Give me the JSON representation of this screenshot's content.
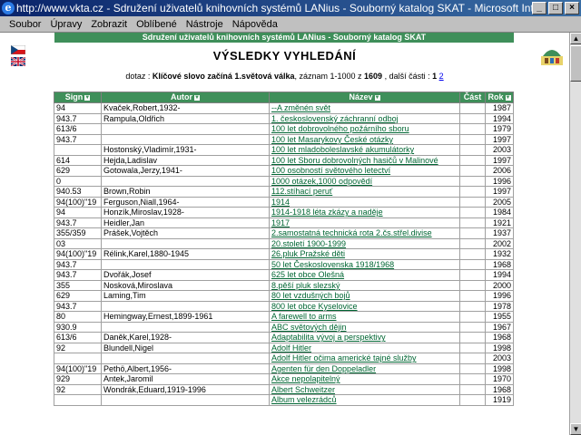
{
  "window": {
    "title": "http://www.vkta.cz - Sdružení uživatelů knihovních systémů LANius - Souborný katalog SKAT - Microsoft Interne..."
  },
  "menu": [
    "Soubor",
    "Úpravy",
    "Zobrazit",
    "Oblíbené",
    "Nástroje",
    "Nápověda"
  ],
  "banner": "Sdružení uživatelů knihovních systémů LANius - Souborný katalog SKAT",
  "heading": "VÝSLEDKY VYHLEDÁNÍ",
  "query": {
    "prefix": "dotaz : ",
    "query_text": "Klíčové slovo začíná 1.světová válka",
    "middle": ", záznam 1-1000 z ",
    "total": "1609",
    "suffix": " , další části : ",
    "current_page": "1",
    "next_page": "2"
  },
  "table": {
    "headers": [
      "Sign",
      "Autor",
      "Název",
      "Část",
      "Rok"
    ],
    "rows": [
      {
        "sign": "94",
        "author": "Kvaček,Robert,1932-",
        "title": "--A změnén svět",
        "part": "",
        "year": "1987"
      },
      {
        "sign": "943.7",
        "author": "Rampula,Oldřich",
        "title": "1. československý záchranní odboj",
        "part": "",
        "year": "1994"
      },
      {
        "sign": "613/6",
        "author": "",
        "title": "100 let dobrovolného požárního sboru",
        "part": "",
        "year": "1979"
      },
      {
        "sign": "943.7",
        "author": "",
        "title": "100 let Masarykovy České otázky",
        "part": "",
        "year": "1997"
      },
      {
        "sign": "",
        "author": "Hostonský,Vladimír,1931-",
        "title": "100 let mladoboleslavské akumulátorky",
        "part": "",
        "year": "2003"
      },
      {
        "sign": "614",
        "author": "Hejda,Ladislav",
        "title": "100 let Sboru dobrovolných hasičů v Malinové",
        "part": "",
        "year": "1997"
      },
      {
        "sign": "629",
        "author": "Gotowala,Jerzy,1941-",
        "title": "100 osobností světového letectví",
        "part": "",
        "year": "2006"
      },
      {
        "sign": "0",
        "author": "",
        "title": "1000 otázek,1000 odpovědí",
        "part": "",
        "year": "1996"
      },
      {
        "sign": "940.53",
        "author": "Brown,Robin",
        "title": "112.stíhací peruť",
        "part": "",
        "year": "1997"
      },
      {
        "sign": "94(100)\"19",
        "author": "Ferguson,Niall,1964-",
        "title": "1914",
        "part": "",
        "year": "2005"
      },
      {
        "sign": "94",
        "author": "Honzík,Miroslav,1928-",
        "title": "1914-1918 léta zkázy a naděje",
        "part": "",
        "year": "1984"
      },
      {
        "sign": "943.7",
        "author": "Heidler,Jan",
        "title": "1917",
        "part": "",
        "year": "1921"
      },
      {
        "sign": "355/359",
        "author": "Prášek,Vojtěch",
        "title": "2.samostatná technická rota 2.čs.střel.divise",
        "part": "",
        "year": "1937"
      },
      {
        "sign": "03",
        "author": "",
        "title": "20.století 1900-1999",
        "part": "",
        "year": "2002"
      },
      {
        "sign": "94(100)\"19",
        "author": "Rélink,Karel,1880-1945",
        "title": "26.pluk Pražské děti",
        "part": "",
        "year": "1932"
      },
      {
        "sign": "943.7",
        "author": "",
        "title": "50 let Československa 1918/1968",
        "part": "",
        "year": "1968"
      },
      {
        "sign": "943.7",
        "author": "Dvořák,Josef",
        "title": "625 let obce Olešná",
        "part": "",
        "year": "1994"
      },
      {
        "sign": "355",
        "author": "Nosková,Miroslava",
        "title": "8.pěší pluk slezský",
        "part": "",
        "year": "2000"
      },
      {
        "sign": "629",
        "author": "Laming,Tim",
        "title": "80 let vzdušných bojů",
        "part": "",
        "year": "1996"
      },
      {
        "sign": "943.7",
        "author": "",
        "title": "800 let obce Kyselovice",
        "part": "",
        "year": "1978"
      },
      {
        "sign": "80",
        "author": "Hemingway,Ernest,1899-1961",
        "title": "A farewell to arms",
        "part": "",
        "year": "1955"
      },
      {
        "sign": "930.9",
        "author": "",
        "title": "ABC světových dějin",
        "part": "",
        "year": "1967"
      },
      {
        "sign": "613/6",
        "author": "Daněk,Karel,1928-",
        "title": "Adaptabilita vývoj a perspektivy",
        "part": "",
        "year": "1968"
      },
      {
        "sign": "92",
        "author": "Blundell,Nigel",
        "title": "Adolf Hitler",
        "part": "",
        "year": "1998"
      },
      {
        "sign": "",
        "author": "",
        "title": "Adolf Hitler očima americké tajné služby",
        "part": "",
        "year": "2003"
      },
      {
        "sign": "94(100)\"19",
        "author": "Pethö,Albert,1956-",
        "title": "Agenten für den Doppeladler",
        "part": "",
        "year": "1998"
      },
      {
        "sign": "929",
        "author": "Antek,Jaromil",
        "title": "Akce nepolapitelný",
        "part": "",
        "year": "1970"
      },
      {
        "sign": "92",
        "author": "Wondrák,Eduard,1919-1996",
        "title": "Albert Schweitzer",
        "part": "",
        "year": "1968"
      },
      {
        "sign": "",
        "author": "",
        "title": "Album velezrádců",
        "part": "",
        "year": "1919"
      }
    ]
  },
  "colors": {
    "accent": "#3f8f5a",
    "link": "#006633",
    "titlebar": "#0a246a"
  },
  "icons": {
    "flag_cz": "czech-flag-icon",
    "flag_gb": "british-flag-icon",
    "logo": "lanius-logo-icon",
    "sort": "sort-icon"
  }
}
